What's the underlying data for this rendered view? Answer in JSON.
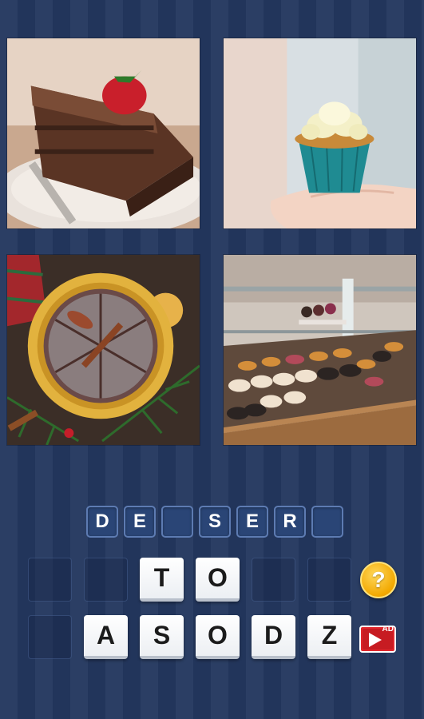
{
  "puzzle": {
    "images": [
      {
        "icon": "chocolate-cake-slice"
      },
      {
        "icon": "cupcake-in-hand"
      },
      {
        "icon": "cinnamon-cake-plate"
      },
      {
        "icon": "pastry-display-case"
      }
    ],
    "answer_slots": [
      "D",
      "E",
      "",
      "S",
      "E",
      "R",
      ""
    ],
    "letter_bank_row1": [
      "",
      "",
      "T",
      "O",
      "",
      ""
    ],
    "letter_bank_row2": [
      "",
      "A",
      "S",
      "O",
      "D",
      "Z"
    ]
  },
  "controls": {
    "hint_label": "?",
    "ad_label": "AD"
  },
  "colors": {
    "background": "#23375e",
    "hint": "#f2a800",
    "ad": "#e0262c"
  }
}
